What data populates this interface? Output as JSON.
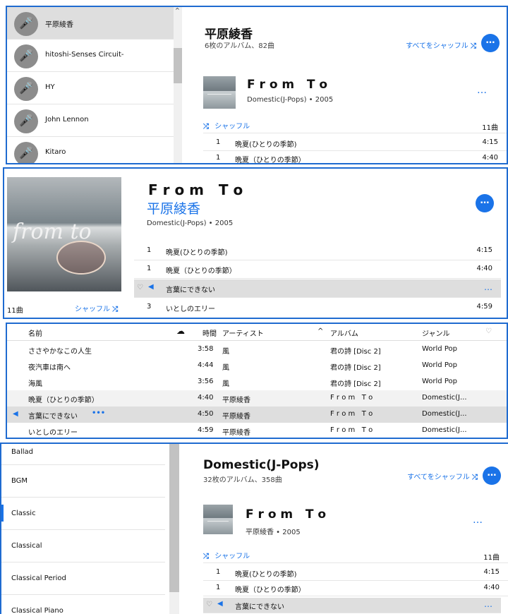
{
  "artist_panel": {
    "artists": [
      "平原綾香",
      "hitoshi-Senses Circuit-",
      "HY",
      "John Lennon",
      "Kitaro"
    ],
    "title": "平原綾香",
    "subtitle": "6枚のアルバム、82曲",
    "shuffle_all_label": "すべてをシャッフル",
    "more_label": "…",
    "album": {
      "title": "F r o m   T o",
      "meta": "Domestic(J-Pops) • 2005",
      "more_label": "…",
      "shuffle_label": "シャッフル",
      "track_count": "11曲",
      "tracks": [
        {
          "no": "1",
          "title": "晩夏(ひとりの季節)",
          "duration": "4:15"
        },
        {
          "no": "1",
          "title": "晩夏（ひとりの季節）",
          "duration": "4:40"
        }
      ]
    }
  },
  "album_panel": {
    "title": "F r o m   T o",
    "artist": "平原綾香",
    "meta": "Domestic(J-Pops) • 2005",
    "more_label": "…",
    "art_text": "from to",
    "track_count": "11曲",
    "shuffle_label": "シャッフル",
    "tracks": [
      {
        "no": "1",
        "title": "晩夏(ひとりの季節)",
        "duration": "4:15"
      },
      {
        "no": "1",
        "title": "晩夏（ひとりの季節）",
        "duration": "4:40"
      },
      {
        "no": "",
        "title": "言葉にできない",
        "duration": "…"
      },
      {
        "no": "3",
        "title": "いとしのエリー",
        "duration": "4:59"
      }
    ]
  },
  "song_table": {
    "headers": {
      "name": "名前",
      "time": "時間",
      "artist": "アーティスト",
      "album": "アルバム",
      "genre": "ジャンル"
    },
    "rows": [
      {
        "name": "ささやかなこの人生",
        "time": "3:58",
        "artist": "風",
        "album": "君の詩 [Disc 2]",
        "genre": "World Pop"
      },
      {
        "name": "夜汽車は南へ",
        "time": "4:44",
        "artist": "風",
        "album": "君の詩 [Disc 2]",
        "genre": "World Pop"
      },
      {
        "name": "海風",
        "time": "3:56",
        "artist": "風",
        "album": "君の詩 [Disc 2]",
        "genre": "World Pop"
      },
      {
        "name": "晩夏（ひとりの季節）",
        "time": "4:40",
        "artist": "平原綾香",
        "album": "F r o m   T o",
        "genre": "Domestic(J..."
      },
      {
        "name": "言葉にできない",
        "time": "4:50",
        "artist": "平原綾香",
        "album": "F r o m   T o",
        "genre": "Domestic(J..."
      },
      {
        "name": "いとしのエリー",
        "time": "4:59",
        "artist": "平原綾香",
        "album": "F r o m   T o",
        "genre": "Domestic(J..."
      }
    ],
    "row_more": "•••"
  },
  "genre_panel": {
    "genres": [
      "Ballad",
      "BGM",
      "Classic",
      "Classical",
      "Classical Period",
      "Classical Piano"
    ],
    "title": "Domestic(J-Pops)",
    "subtitle": "32枚のアルバム、358曲",
    "shuffle_all_label": "すべてをシャッフル",
    "more_label": "…",
    "album": {
      "title": "F r o m   T o",
      "meta": "平原綾香 • 2005",
      "more_label": "…",
      "shuffle_label": "シャッフル",
      "track_count": "11曲",
      "tracks": [
        {
          "no": "1",
          "title": "晩夏(ひとりの季節)",
          "duration": "4:15"
        },
        {
          "no": "1",
          "title": "晩夏（ひとりの季節）",
          "duration": "4:40"
        },
        {
          "no": "",
          "title": "言葉にできない",
          "duration": "…"
        }
      ]
    }
  },
  "colors": {
    "accent": "#1a73e8",
    "border": "#1f6bd0",
    "selected": "#dedede"
  }
}
